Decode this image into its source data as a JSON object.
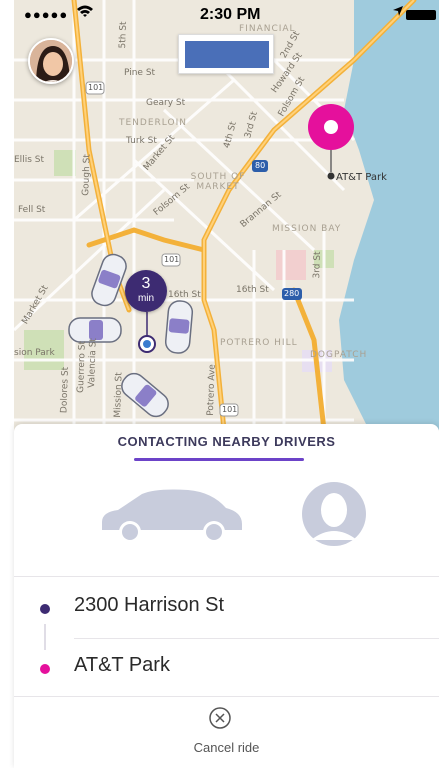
{
  "status_bar": {
    "signal": "●●●●●",
    "time": "2:30 PM"
  },
  "map": {
    "labels": {
      "financial": "FINANCIAL",
      "pine": "Pine St",
      "geary": "Geary St",
      "tenderloin": "TENDERLOIN",
      "turk": "Turk St",
      "ellis": "Ellis St",
      "fell": "Fell St",
      "market_w": "Market St",
      "market_e": "Market St",
      "gough": "Gough St",
      "folsom": "Folsom St",
      "folsom2": "Folsom St",
      "howard": "Howard St",
      "second": "2nd St",
      "third": "3rd St",
      "third_s": "3rd St",
      "fourth": "4th St",
      "fifth": "5th St",
      "brannan": "Brannan St",
      "south_market": "SOUTH OF MARKET",
      "mission_bay": "MISSION BAY",
      "att_park": "AT&T Park",
      "sixteenth": "16th St",
      "potrero_hill": "POTRERO HILL",
      "potrero_ave": "Potrero Ave",
      "dogpatch": "DOGPATCH",
      "mission_park": "sion Park",
      "valencia": "Valencia St",
      "guerrero": "Guerrero St",
      "dolores": "Dolores St",
      "mission_st": "Mission St",
      "folsom_s": "Folsom St",
      "sixteenth_w": "16th St",
      "hwy101a": "101",
      "hwy101b": "101",
      "hwy101c": "101",
      "hwy80": "80",
      "hwy280": "280"
    },
    "eta": {
      "value": "3",
      "unit": "min"
    }
  },
  "panel": {
    "title": "CONTACTING NEARBY DRIVERS",
    "pickup": "2300 Harrison St",
    "dropoff": "AT&T Park",
    "cancel_label": "Cancel ride"
  },
  "colors": {
    "accent_purple": "#6c43c8",
    "pickup_dot": "#3d2b72",
    "dropoff_pink": "#e5109c",
    "water": "#8fc3d6"
  },
  "icons": [
    "avatar",
    "car-icon",
    "driver-silhouette-icon",
    "close-circle-icon",
    "pin-icon",
    "location-arrow-icon",
    "wifi-icon"
  ]
}
